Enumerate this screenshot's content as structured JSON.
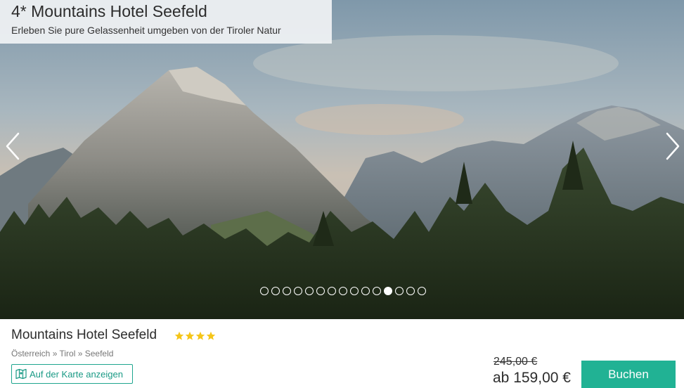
{
  "hero": {
    "title": "4* Mountains Hotel Seefeld",
    "subtitle": "Erleben Sie pure Gelassenheit umgeben von der Tiroler Natur",
    "slides_total": 15,
    "active_slide": 11,
    "icons": {
      "prev": "chevron-left-icon",
      "next": "chevron-right-icon"
    }
  },
  "hotel": {
    "name": "Mountains Hotel Seefeld",
    "star_rating": 4,
    "breadcrumb": [
      "Österreich",
      "Tirol",
      "Seefeld"
    ],
    "breadcrumb_separator": " » ",
    "map_link_label": "Auf der Karte anzeigen",
    "map_icon": "map-icon"
  },
  "pricing": {
    "old_price": "245,00 €",
    "new_price": "ab 159,00 €",
    "book_label": "Buchen"
  },
  "colors": {
    "accent": "#21b294",
    "link": "#1a9a85",
    "star": "#f5c518"
  }
}
